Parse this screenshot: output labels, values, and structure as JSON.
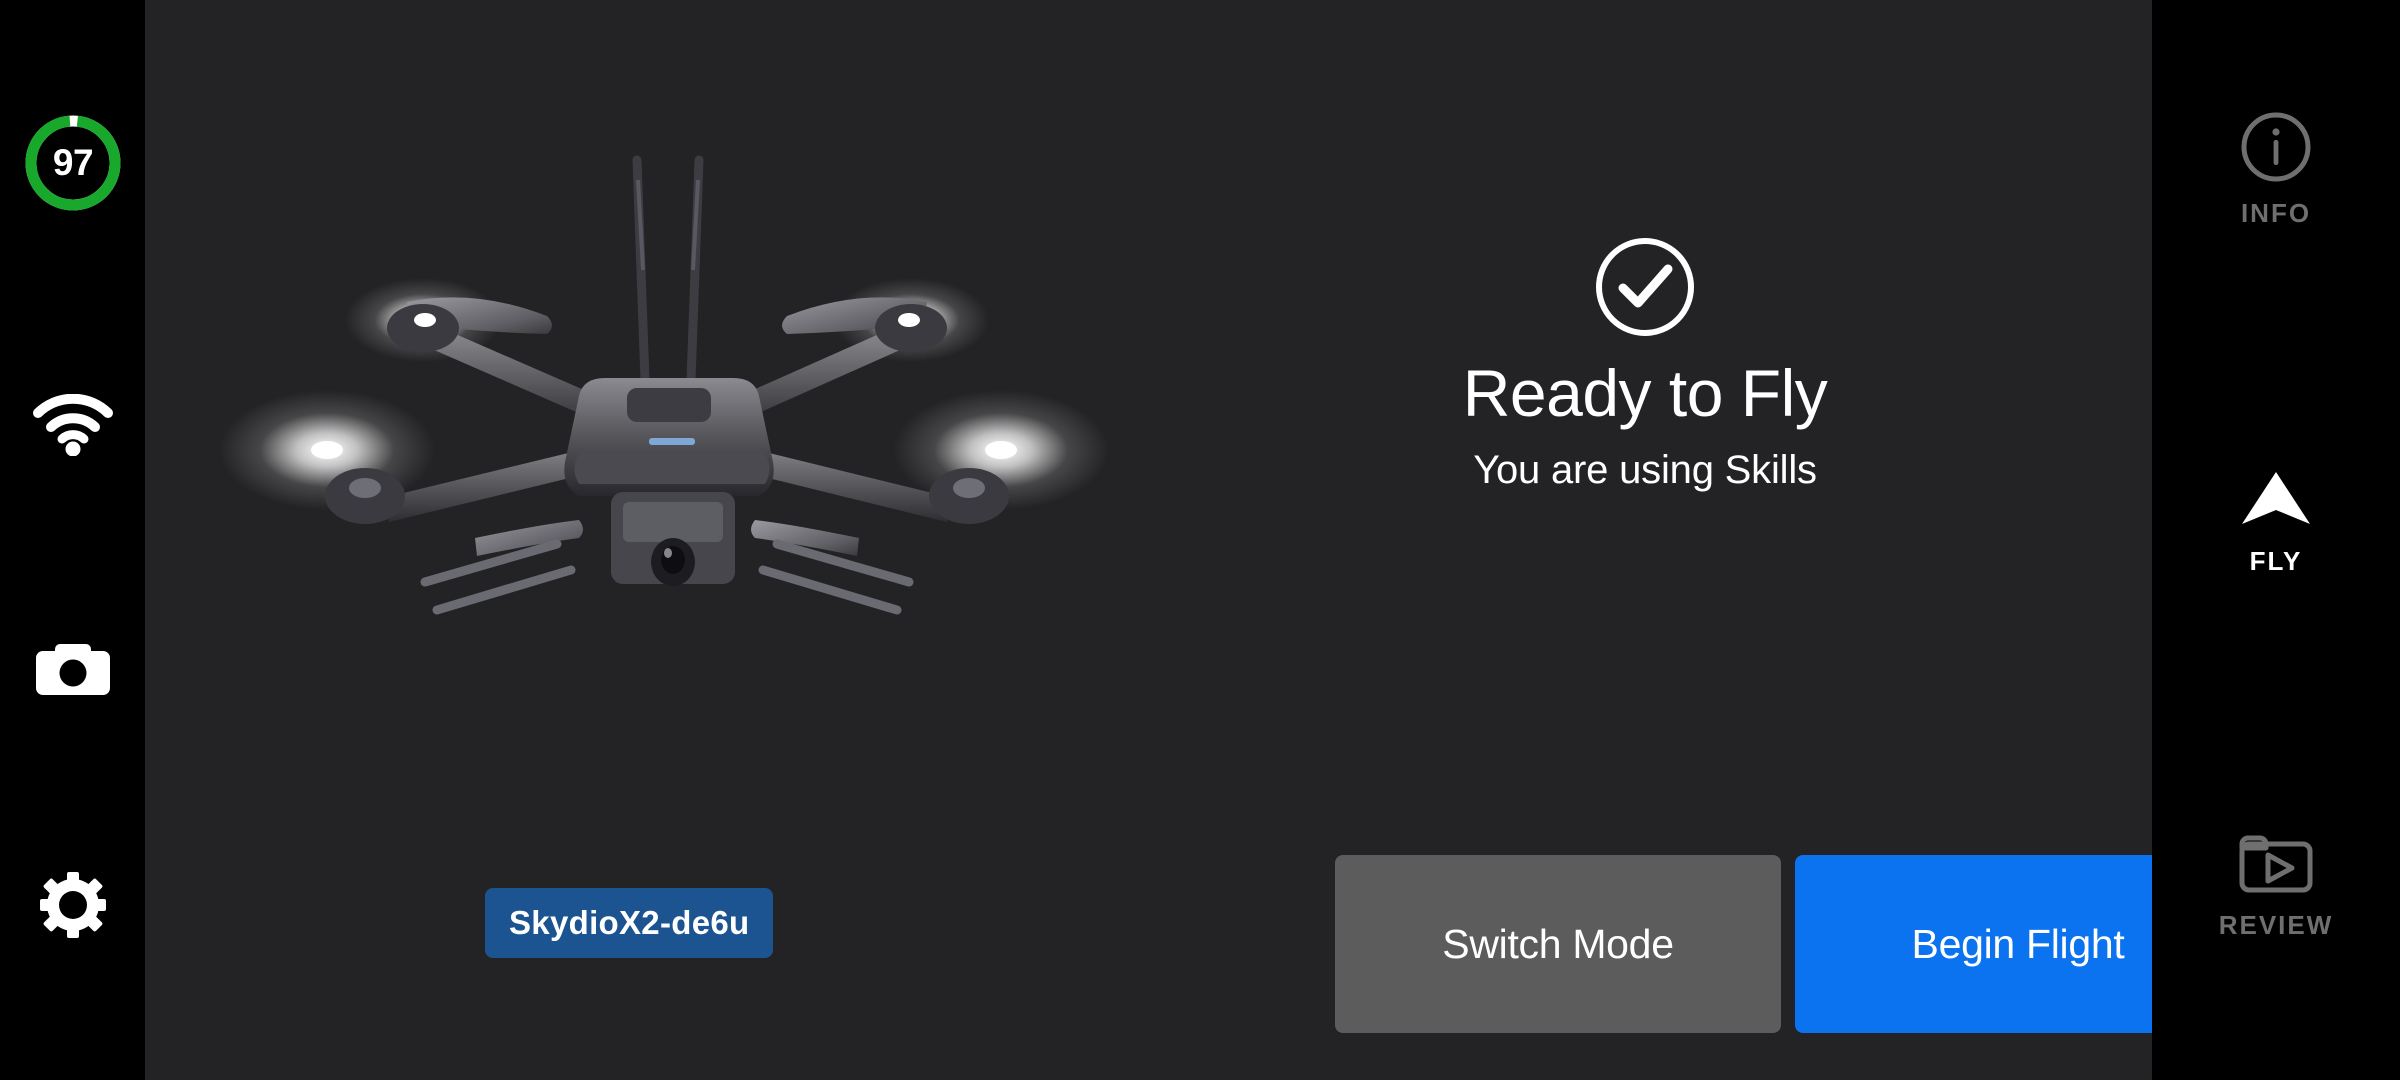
{
  "theme": {
    "rail_bg": "#000000",
    "panel_bg": "#232325",
    "accent_blue": "#0b72f0",
    "badge_blue": "#1b5490",
    "secondary_gray": "#5c5c5c",
    "battery_green": "#18a92c",
    "inactive_gray": "#6f6f6f",
    "text_white": "#ffffff"
  },
  "left_rail": {
    "battery": {
      "value": "97",
      "percent": 97,
      "unit": "%",
      "icon": "battery-ring-icon",
      "color": "#18a92c"
    },
    "items": [
      {
        "icon": "wifi-icon",
        "name": "wifi-status-icon"
      },
      {
        "icon": "camera-icon",
        "name": "camera-button"
      },
      {
        "icon": "gear-icon",
        "name": "settings-button"
      }
    ]
  },
  "main": {
    "drone": {
      "icon": "drone-illustration",
      "alt": "Skydio X2 quadcopter"
    },
    "device_badge": {
      "label": "SkydioX2-de6u"
    },
    "status": {
      "icon": "check-circle-icon",
      "title": "Ready to Fly",
      "subtitle": "You are using Skills"
    },
    "actions": [
      {
        "label": "Switch Mode",
        "style": "secondary"
      },
      {
        "label": "Begin Flight",
        "style": "primary"
      }
    ]
  },
  "right_rail": {
    "items": [
      {
        "label": "INFO",
        "icon": "info-circle-icon",
        "active": false
      },
      {
        "label": "FLY",
        "icon": "navigation-arrow-icon",
        "active": true
      },
      {
        "label": "REVIEW",
        "icon": "folder-play-icon",
        "active": false
      }
    ]
  }
}
